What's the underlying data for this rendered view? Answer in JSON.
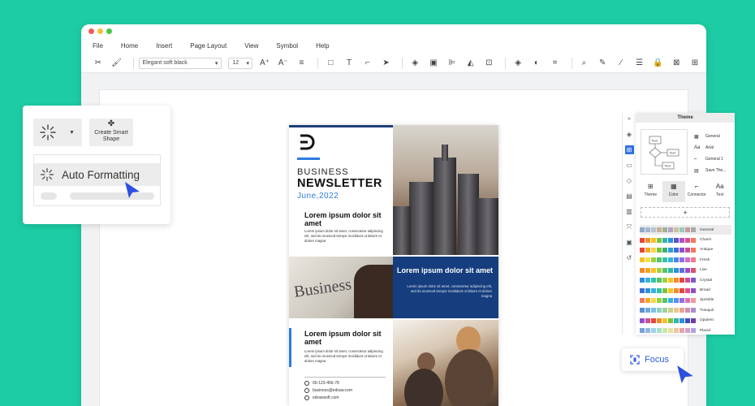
{
  "menu": [
    "File",
    "Home",
    "Insert",
    "Page Layout",
    "View",
    "Symbol",
    "Help"
  ],
  "toolbar": {
    "font": "Elegant soft black",
    "size": "12",
    "icons": [
      "scissors-icon",
      "format-painter-icon",
      "font-grow-icon",
      "font-shrink-icon",
      "align-icon",
      "rectangle-icon",
      "text-icon",
      "connector-icon",
      "pointer-icon",
      "layers-icon",
      "group-icon",
      "align-left-icon",
      "flip-icon",
      "position-icon",
      "fill-icon",
      "shape-style-icon",
      "crop-icon",
      "search-icon",
      "note-icon",
      "line-color-icon",
      "line-style-icon",
      "lock-icon",
      "close-box-icon",
      "more-icon"
    ]
  },
  "left_panel": {
    "smart_shape_label": "Create Smart Shape",
    "auto_formatting_label": "Auto Formatting"
  },
  "newsletter": {
    "business": "BUSINESS",
    "newsletter": "NEWSLETTER",
    "date": "June,2022",
    "heading1": "Lorem ipsum dolor sit amet",
    "body1": "Lorem ipsum dolor sit amet, consectetur adipiscing elit, sed do eiusmod tempor incididunt ut labore et dolore magna",
    "newspaper_word": "Business",
    "heading_blue": "Lorem ipsum dolor sit amet",
    "body_blue": "Lorem ipsum dolor sit amet, consectetur adipiscing elit, sed do eiusmod tempor incididunt ut labore et dolore magna",
    "heading2": "Lorem ipsum dolor sit amet",
    "body2": "Lorem ipsum dolor sit amet, consectetur adipiscing elit, sed do eiusmod tempor incididunt ut labore et dolore magna",
    "phone": "00-123-456-78",
    "email": "business@edraw.com",
    "web": "edrawsoft.com"
  },
  "theme_panel": {
    "title": "Theme",
    "preview_text": [
      "Text",
      "Text",
      "Text"
    ],
    "options": [
      {
        "icon": "color-grid-icon",
        "label": "General"
      },
      {
        "icon": "font-icon",
        "label": "Arial"
      },
      {
        "icon": "connector-style-icon",
        "label": "General 1"
      },
      {
        "icon": "save-theme-icon",
        "label": "Save The..."
      }
    ],
    "tabs": [
      {
        "icon": "theme-icon",
        "label": "Theme"
      },
      {
        "icon": "color-icon",
        "label": "Color"
      },
      {
        "icon": "connector-icon",
        "label": "Connector"
      },
      {
        "icon": "text-icon",
        "label": "Text"
      }
    ],
    "add_label": "+",
    "palettes": [
      {
        "name": "General",
        "colors": [
          "#8fa9c9",
          "#a3b6cc",
          "#b7c4d4",
          "#c9b09a",
          "#9fb48f",
          "#b79fc9",
          "#c9c39a",
          "#9ac9c3",
          "#c99a9a",
          "#aaaaaa"
        ]
      },
      {
        "name": "Charm",
        "colors": [
          "#e8453c",
          "#f28c28",
          "#f5c325",
          "#7cc242",
          "#2fb8a6",
          "#2f8fd9",
          "#5a4fcf",
          "#b04fc9",
          "#e04f8f",
          "#f07a5a"
        ]
      },
      {
        "name": "Antique",
        "colors": [
          "#e8453c",
          "#f5a623",
          "#f8d74a",
          "#7cc242",
          "#3bb273",
          "#2f9bd9",
          "#3b6fd1",
          "#8f4fc9",
          "#c94f9b",
          "#f27a5a"
        ]
      },
      {
        "name": "Fresh",
        "colors": [
          "#f5c325",
          "#f5e04a",
          "#9bd13f",
          "#52c46a",
          "#32c4a8",
          "#38b2e0",
          "#4f84e8",
          "#8f6fe0",
          "#d06fc9",
          "#f07a8f"
        ]
      },
      {
        "name": "Live",
        "colors": [
          "#f28c28",
          "#f5a623",
          "#f5c325",
          "#a8d13f",
          "#52c46a",
          "#2fb8a6",
          "#2f8fd9",
          "#5a6fd1",
          "#9b4fc9",
          "#e04f6f"
        ]
      },
      {
        "name": "Crystal",
        "colors": [
          "#2f8fd9",
          "#38b2e0",
          "#32c4a8",
          "#52c46a",
          "#9bd13f",
          "#f5c325",
          "#f28c28",
          "#e8453c",
          "#c94f9b",
          "#7a5ad1"
        ]
      },
      {
        "name": "Broad",
        "colors": [
          "#3b6fd1",
          "#2f8fd9",
          "#38b2e0",
          "#32c4a8",
          "#7cc242",
          "#f5c325",
          "#f28c28",
          "#e8453c",
          "#e04f8f",
          "#8f4fc9"
        ]
      },
      {
        "name": "Sprinkle",
        "colors": [
          "#f07a5a",
          "#f5a623",
          "#f5d74a",
          "#9bd13f",
          "#52c46a",
          "#38b2e0",
          "#5a8fe8",
          "#8f6fe0",
          "#e06fb0",
          "#f09a9a"
        ]
      },
      {
        "name": "Tranquil",
        "colors": [
          "#5a8fd1",
          "#6fa8e0",
          "#7fc0e8",
          "#8fd1c9",
          "#9fd19f",
          "#c9d18f",
          "#e8c98f",
          "#e8a38f",
          "#d18fb0",
          "#a38fd1"
        ]
      },
      {
        "name": "Opulent",
        "colors": [
          "#8f4fc9",
          "#c94f9b",
          "#e8453c",
          "#f28c28",
          "#f5c325",
          "#7cc242",
          "#2fb8a6",
          "#2f8fd9",
          "#3b4fb8",
          "#6f3fa8"
        ]
      },
      {
        "name": "Placid",
        "colors": [
          "#7a9fd9",
          "#8fb8e0",
          "#9fd1e8",
          "#a3e0c9",
          "#c9e8a3",
          "#e8e0a3",
          "#e8c9a3",
          "#e8a3a3",
          "#d1a3c9",
          "#b0a3e0"
        ]
      }
    ]
  },
  "focus_label": "Focus"
}
